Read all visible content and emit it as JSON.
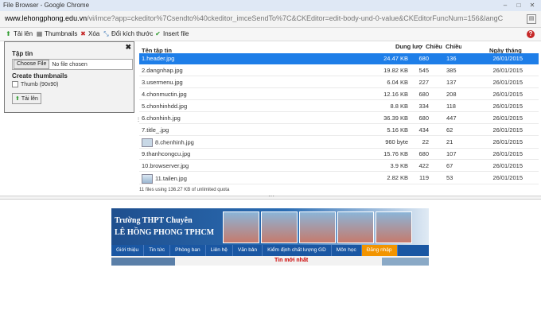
{
  "window": {
    "title": "File Browser - Google Chrome"
  },
  "address_bar": {
    "domain": "www.lehongphong.edu.vn",
    "path": "/vi/imce?app=ckeditor%7Csendto%40ckeditor_imceSendTo%7C&CKEditor=edit-body-und-0-value&CKEditorFuncNum=156&langC"
  },
  "toolbar": {
    "upload": "Tải lên",
    "thumbnails": "Thumbnails",
    "delete": "Xóa",
    "resize": "Đổi kích thước",
    "insert": "Insert file"
  },
  "upload_panel": {
    "file_label": "Tập tin",
    "choose_button": "Choose File",
    "no_file": "No file chosen",
    "thumbnails_label": "Create thumbnails",
    "thumb_option": "Thumb (90x90)",
    "upload_button": "Tải lên"
  },
  "file_list": {
    "columns": {
      "name": "Tên tập tin",
      "size": "Dung lượng",
      "width": "Chiều rộng",
      "height": "Chiều cao",
      "date": "Ngày tháng"
    },
    "rows": [
      {
        "name": "1.header.jpg",
        "size": "24.47 KB",
        "width": "680",
        "height": "136",
        "date": "26/01/2015",
        "selected": true
      },
      {
        "name": "2.dangnhap.jpg",
        "size": "19.82 KB",
        "width": "545",
        "height": "385",
        "date": "26/01/2015"
      },
      {
        "name": "3.usermenu.jpg",
        "size": "6.04 KB",
        "width": "227",
        "height": "137",
        "date": "26/01/2015"
      },
      {
        "name": "4.chonmuctin.jpg",
        "size": "12.16 KB",
        "width": "680",
        "height": "208",
        "date": "26/01/2015"
      },
      {
        "name": "5.chonhinhdd.jpg",
        "size": "8.8 KB",
        "width": "334",
        "height": "118",
        "date": "26/01/2015"
      },
      {
        "name": "6.chonhinh.jpg",
        "size": "36.39 KB",
        "width": "680",
        "height": "447",
        "date": "26/01/2015"
      },
      {
        "name": "7.title_.jpg",
        "size": "5.16 KB",
        "width": "434",
        "height": "62",
        "date": "26/01/2015"
      },
      {
        "name": "8.chenhinh.jpg",
        "size": "960 byte",
        "width": "22",
        "height": "21",
        "date": "26/01/2015",
        "thumb": true
      },
      {
        "name": "9.thanhcongcu.jpg",
        "size": "15.76 KB",
        "width": "680",
        "height": "107",
        "date": "26/01/2015"
      },
      {
        "name": "10.browserver.jpg",
        "size": "3.9 KB",
        "width": "422",
        "height": "67",
        "date": "26/01/2015"
      },
      {
        "name": "11.tailen.jpg",
        "size": "2.82 KB",
        "width": "119",
        "height": "53",
        "date": "26/01/2015",
        "thumb": true
      }
    ],
    "status": "11 files using 136.27 KB of unlimited quota"
  },
  "preview": {
    "line1": "Trường THPT Chuyên",
    "line2": "LÊ HỒNG PHONG TPHCM",
    "menu": [
      "Giới thiệu",
      "Tin tức",
      "Phòng ban",
      "Liên hệ",
      "Văn bản",
      "Kiểm định chất lượng GD",
      "Môn học",
      "Đăng nhập"
    ],
    "news_heading": "Tin mới nhất"
  },
  "colors": {
    "selection": "#1e7ee8",
    "menu_bg": "#1a57a3",
    "menu_active": "#f29400"
  }
}
